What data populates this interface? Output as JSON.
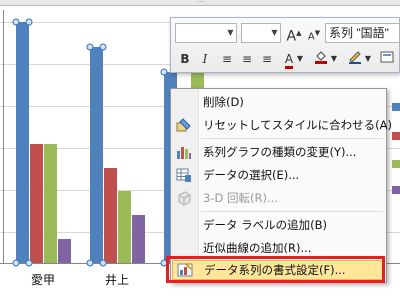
{
  "chart": {
    "categories": [
      "愛甲",
      "井上"
    ],
    "colors": {
      "blue": "#4f81bd",
      "red": "#c0504d",
      "green": "#9bbb59",
      "purple": "#8064a2"
    }
  },
  "mini_toolbar": {
    "font_grow_label": "A",
    "font_shrink_label": "A",
    "series_select": "系列 \"国語\"",
    "bold_label": "B",
    "italic_label": "I"
  },
  "context_menu": {
    "items": [
      {
        "label": "削除(D)",
        "icon": "none",
        "enabled": true
      },
      {
        "label": "リセットしてスタイルに合わせる(A)",
        "icon": "reset-style-icon",
        "enabled": true
      },
      {
        "label": "系列グラフの種類の変更(Y)...",
        "icon": "chart-type-icon",
        "enabled": true
      },
      {
        "label": "データの選択(E)...",
        "icon": "select-data-icon",
        "enabled": true
      },
      {
        "label": "3-D 回転(R)...",
        "icon": "rotate-3d-icon",
        "enabled": false
      },
      {
        "label": "データ ラベルの追加(B)",
        "icon": "none",
        "enabled": true
      },
      {
        "label": "近似曲線の追加(R)...",
        "icon": "none",
        "enabled": true
      },
      {
        "label": "データ系列の書式設定(F)...",
        "icon": "format-series-icon",
        "enabled": true,
        "highlighted": true
      }
    ]
  }
}
